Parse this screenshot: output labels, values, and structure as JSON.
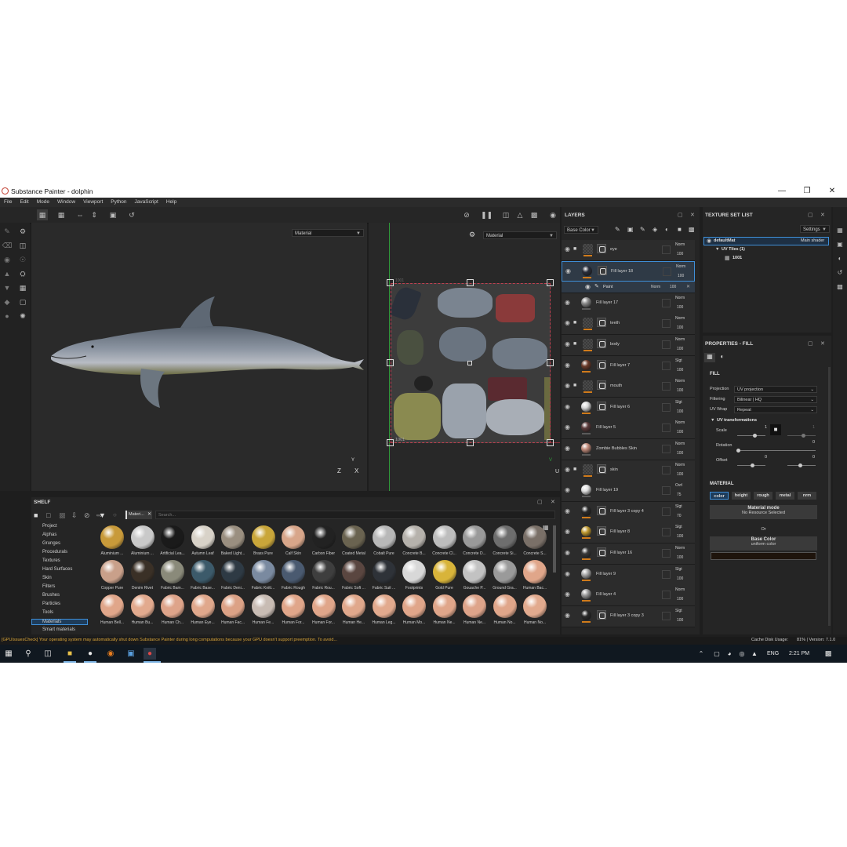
{
  "window": {
    "title": "Substance Painter - dolphin"
  },
  "menu": [
    "File",
    "Edit",
    "Mode",
    "Window",
    "Viewport",
    "Python",
    "JavaScript",
    "Help"
  ],
  "viewport3d": {
    "channel_select": "Material",
    "axis_z": "Z",
    "axis_x": "X",
    "axis_y": "Y"
  },
  "viewport2d": {
    "channel_select": "Material",
    "tile_label": "1001",
    "tile_label_top": "1001",
    "axis_u": "U",
    "axis_v": "V"
  },
  "shelf": {
    "title": "SHELF",
    "filter_tag": "Materi...",
    "search_placeholder": "Search...",
    "categories": [
      "Project",
      "Alphas",
      "Grunges",
      "Procedurals",
      "Textures",
      "Hard Surfaces",
      "Skin",
      "Filters",
      "Brushes",
      "Particles",
      "Tools",
      "Materials",
      "Smart materials"
    ],
    "selected_category": "Materials",
    "materials": [
      {
        "name": "Aluminium ...",
        "color": "#c89a3a"
      },
      {
        "name": "Aluminium ...",
        "color": "#c9c9c9"
      },
      {
        "name": "Artificial Lea...",
        "color": "#1a1a1a"
      },
      {
        "name": "Autumn Leaf",
        "color": "#d8d2c8"
      },
      {
        "name": "Baked Light...",
        "color": "#9a8f80"
      },
      {
        "name": "Brass Pure",
        "color": "#c9a63a"
      },
      {
        "name": "Calf Skin",
        "color": "#d8a68a"
      },
      {
        "name": "Carbon Fiber",
        "color": "#222222"
      },
      {
        "name": "Coated Metal",
        "color": "#6a6350"
      },
      {
        "name": "Cobalt Pure",
        "color": "#b8b8b8"
      },
      {
        "name": "Concrete B...",
        "color": "#b6b2ac"
      },
      {
        "name": "Concrete Cl...",
        "color": "#bdbdbd"
      },
      {
        "name": "Concrete D...",
        "color": "#9a9a9a"
      },
      {
        "name": "Concrete Si...",
        "color": "#6e6e6e"
      },
      {
        "name": "Concrete S...",
        "color": "#7a7068"
      },
      {
        "name": "Copper Pure",
        "color": "#c9a08a"
      },
      {
        "name": "Denim Rivet",
        "color": "#3a3026"
      },
      {
        "name": "Fabric Bam...",
        "color": "#8a8a7a"
      },
      {
        "name": "Fabric Base...",
        "color": "#3c5a6a"
      },
      {
        "name": "Fabric Deni...",
        "color": "#2e3a44"
      },
      {
        "name": "Fabric Knitt...",
        "color": "#7a8aa0"
      },
      {
        "name": "Fabric Rough",
        "color": "#4a5a70"
      },
      {
        "name": "Fabric Rou...",
        "color": "#3e3e3e"
      },
      {
        "name": "Fabric Soft ...",
        "color": "#5a4640"
      },
      {
        "name": "Fabric Suit ...",
        "color": "#2e3238"
      },
      {
        "name": "Footprints",
        "color": "#d8d8d8"
      },
      {
        "name": "Gold Pure",
        "color": "#d8b43a"
      },
      {
        "name": "Gouache P...",
        "color": "#c2c2c2"
      },
      {
        "name": "Ground Gra...",
        "color": "#9a9a9a"
      },
      {
        "name": "Human Bac...",
        "color": "#e0a68a"
      },
      {
        "name": "Human Bell...",
        "color": "#e0a68a"
      },
      {
        "name": "Human Bu...",
        "color": "#e2aa8e"
      },
      {
        "name": "Human Ch...",
        "color": "#dea48a"
      },
      {
        "name": "Human Eye...",
        "color": "#e0a88c"
      },
      {
        "name": "Human Fac...",
        "color": "#dca286"
      },
      {
        "name": "Human Fe...",
        "color": "#c8bcb4"
      },
      {
        "name": "Human For...",
        "color": "#e0a68a"
      },
      {
        "name": "Human For...",
        "color": "#e0a68a"
      },
      {
        "name": "Human He...",
        "color": "#e0a88c"
      },
      {
        "name": "Human Leg...",
        "color": "#e2aa8e"
      },
      {
        "name": "Human Mo...",
        "color": "#e0a68a"
      },
      {
        "name": "Human Ne...",
        "color": "#e0a68a"
      },
      {
        "name": "Human Ne...",
        "color": "#dea48a"
      },
      {
        "name": "Human No...",
        "color": "#e0a68a"
      },
      {
        "name": "Human No...",
        "color": "#e2aa8e"
      }
    ]
  },
  "layers": {
    "title": "LAYERS",
    "channel_select": "Base Color",
    "rows": [
      {
        "name": "eye",
        "type": "folder",
        "blend": "Norm",
        "opacity": "100",
        "bar": "orange",
        "thumb": "#3a3a3a"
      },
      {
        "name": "Fill layer 18",
        "type": "fill",
        "blend": "Norm",
        "opacity": "100",
        "bar": "orange",
        "thumb": "#2a2e3a",
        "selected": true
      },
      {
        "name": "Paint",
        "type": "paint",
        "blend": "Norm",
        "opacity": "100"
      },
      {
        "name": "Fill layer 17",
        "type": "fill",
        "blend": "Norm",
        "opacity": "100",
        "bar": "grey",
        "thumb": "#8a8a8a"
      },
      {
        "name": "teeth",
        "type": "folder",
        "blend": "Norm",
        "opacity": "100",
        "bar": "orange",
        "thumb": "#3a3a3a"
      },
      {
        "name": "body",
        "type": "folder",
        "blend": "Norm",
        "opacity": "100",
        "bar": "orange",
        "thumb": "#3a3a3a"
      },
      {
        "name": "Fill layer 7",
        "type": "fill",
        "blend": "Slgt",
        "opacity": "100",
        "bar": "orange",
        "thumb": "#6a3a2a"
      },
      {
        "name": "mouth",
        "type": "folder",
        "blend": "Norm",
        "opacity": "100",
        "bar": "orange",
        "thumb": "#3a3a3a"
      },
      {
        "name": "Fill layer 6",
        "type": "fill",
        "blend": "Slgt",
        "opacity": "100",
        "bar": "orange",
        "thumb": "#d8d8d8"
      },
      {
        "name": "Fill layer 5",
        "type": "fill",
        "blend": "Norm",
        "opacity": "100",
        "bar": "grey",
        "thumb": "#5a3a3a"
      },
      {
        "name": "Zombie Bubbles Skin",
        "type": "fill",
        "blend": "Norm",
        "opacity": "100",
        "bar": "grey",
        "thumb": "#c08a7a"
      },
      {
        "name": "skin",
        "type": "folder",
        "blend": "Norm",
        "opacity": "100",
        "bar": "orange",
        "thumb": "#3a3a3a"
      },
      {
        "name": "Fill layer 19",
        "type": "fill",
        "blend": "Ovrl",
        "opacity": "75",
        "bar": "grey",
        "thumb": "#e0e0e0"
      },
      {
        "name": "Fill layer 3 copy 4",
        "type": "fill",
        "blend": "Slgt",
        "opacity": "70",
        "bar": "orange",
        "thumb": "#2a2a2a"
      },
      {
        "name": "Fill layer 8",
        "type": "fill",
        "blend": "Slgt",
        "opacity": "100",
        "bar": "orange",
        "thumb": "#c09a30"
      },
      {
        "name": "Fill layer 16",
        "type": "fill",
        "blend": "Norm",
        "opacity": "100",
        "bar": "orange",
        "thumb": "#3a3a3a"
      },
      {
        "name": "Fill layer 9",
        "type": "fill",
        "blend": "Slgt",
        "opacity": "100",
        "bar": "orange",
        "thumb": "#a8a8a8"
      },
      {
        "name": "Fill layer 4",
        "type": "fill",
        "blend": "Norm",
        "opacity": "100",
        "bar": "orange",
        "thumb": "#9a9a9a"
      },
      {
        "name": "Fill layer 3 copy 3",
        "type": "fill",
        "blend": "Slgt",
        "opacity": "100",
        "bar": "orange",
        "thumb": "#2a2a2a"
      }
    ]
  },
  "texture_set_list": {
    "title": "TEXTURE SET LIST",
    "settings_label": "Settings",
    "set_name": "defaultMat",
    "shader": "Main shader",
    "uv_tiles": "UV Tiles (1)",
    "tile": "1001"
  },
  "properties": {
    "title": "PROPERTIES - FILL",
    "section_fill": "FILL",
    "projection_label": "Projection",
    "projection_value": "UV projection",
    "filtering_label": "Filtering",
    "filtering_value": "Bilinear | HQ",
    "uvwrap_label": "UV Wrap",
    "uvwrap_value": "Repeat",
    "uv_transformations": "UV transformations",
    "scale_label": "Scale",
    "scale_a": "1",
    "scale_b": "1",
    "rotation_label": "Rotation",
    "rotation_value": "0",
    "offset_label": "Offset",
    "offset_a": "0",
    "offset_b": "0",
    "section_material": "MATERIAL",
    "channels": [
      "color",
      "height",
      "rough",
      "metal",
      "nrm"
    ],
    "material_mode_label": "Material mode",
    "material_mode_value": "No Resource Selected",
    "or_label": "Or",
    "base_color_label": "Base Color",
    "base_color_value": "uniform color",
    "base_color_swatch": "#1e140c"
  },
  "status": {
    "message": "[GPUIssuesCheck] Your operating system may automatically shut down Substance Painter during long computations because your GPU doesn't support preemption. To avoid...",
    "cache": "Cache Disk Usage:",
    "cache_value": "81% | Version: 7.1.0"
  },
  "taskbar": {
    "lang": "ENG",
    "time": "2:21 PM"
  }
}
